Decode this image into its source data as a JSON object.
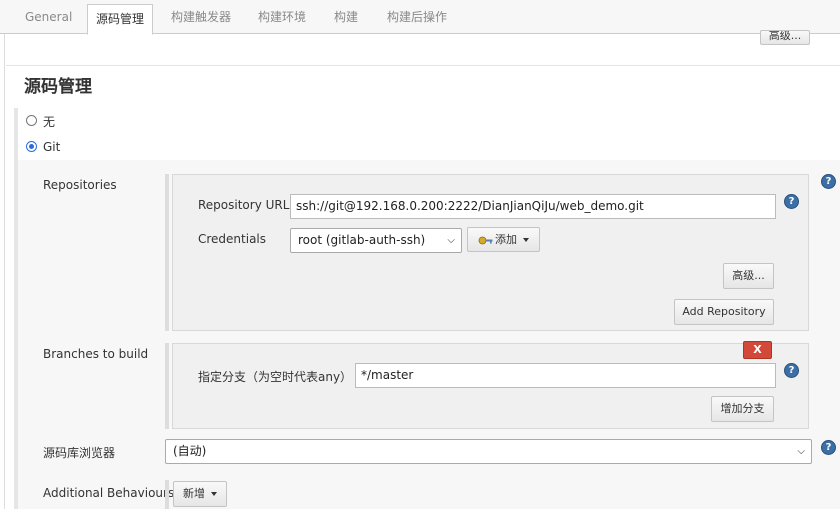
{
  "tabs": [
    {
      "label": "General",
      "active": false
    },
    {
      "label": "源码管理",
      "active": true
    },
    {
      "label": "构建触发器",
      "active": false
    },
    {
      "label": "构建环境",
      "active": false
    },
    {
      "label": "构建",
      "active": false
    },
    {
      "label": "构建后操作",
      "active": false
    }
  ],
  "top_advanced_label": "高级...",
  "section_title": "源码管理",
  "scm_options": [
    {
      "label": "无",
      "selected": false
    },
    {
      "label": "Git",
      "selected": true
    }
  ],
  "repositories": {
    "label": "Repositories",
    "url_label": "Repository URL",
    "url_value": "ssh://git@192.168.0.200:2222/DianJianQiJu/web_demo.git",
    "credentials_label": "Credentials",
    "credentials_value": "root (gitlab-auth-ssh)",
    "add_label": "添加",
    "advanced_label": "高级...",
    "add_repository_label": "Add Repository"
  },
  "branches": {
    "label": "Branches to build",
    "delete_label": "X",
    "branch_label": "指定分支（为空时代表any）",
    "branch_value": "*/master",
    "add_branch_label": "增加分支"
  },
  "browser": {
    "label": "源码库浏览器",
    "value": "(自动)"
  },
  "behaviours": {
    "label": "Additional Behaviours",
    "add_label": "新增"
  },
  "help_glyph": "?",
  "colors": {
    "radio_selected": "#2b6cd8",
    "help_icon": "#3b6fa6",
    "delete_button": "#d24939"
  },
  "icons": {
    "help": "help-icon",
    "key": "key-icon",
    "dropdown": "chevron-down-icon"
  }
}
